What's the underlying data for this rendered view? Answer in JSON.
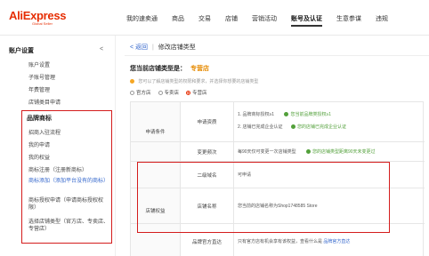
{
  "header": {
    "logo_main": "AliExpress",
    "logo_sub": "Global Seller",
    "nav": [
      "我的速卖通",
      "商品",
      "交易",
      "店铺",
      "营销活动",
      "账号及认证",
      "生意参谋",
      "违规"
    ],
    "active_nav_index": 5
  },
  "sidebar": {
    "section1_title": "账户设置",
    "section1_items": [
      "账户设置",
      "子账号管理",
      "年费管理",
      "店铺类目申请"
    ],
    "section2_title": "品牌商标",
    "section2_items": [
      "招商入驻流程",
      "我的申请",
      "我的权益",
      "商标注册（注册新商标）",
      "商标添加（添加平台没有的商标）",
      "商标授权申请（申请商标授权权限）",
      "选择店铺类型（官方店、专卖店、专营店）"
    ],
    "collapse_symbol": "<"
  },
  "main": {
    "back_link": "< 返回",
    "breadcrumb_sep": "|",
    "page_title": "修改店铺类型",
    "current_type_label": "您当前店铺类型是：",
    "current_type_value": "专营店",
    "notice": "您可以了解店铺类型的权限和要求，并选择你想要的店铺类型",
    "radios": [
      "官方店",
      "专卖店",
      "专营店"
    ],
    "checked_radio_index": 2,
    "table": {
      "category1": "申请条件",
      "category2": "店铺权益",
      "rows": [
        {
          "label": "申请资质",
          "content": "1. 品牌商标授权≥1",
          "status": "您当前品牌类授权≥1",
          "content2": "2. 店铺已完成企业认证",
          "status2": "您的店铺已完成企业认证"
        },
        {
          "label": "变更频次",
          "content": "每90天仅可变更一次店铺类型",
          "status": "您的店铺类型距离90天未变更过"
        },
        {
          "label": "二级域名",
          "content": "可申请"
        },
        {
          "label": "店铺名称",
          "content": "您当前的店铺名称为Shop1748585 Store"
        },
        {
          "label": "品牌官方直达",
          "content": "只有官方店有机会享有该权益，查看什么是",
          "link": "品牌官方直达"
        }
      ]
    }
  }
}
